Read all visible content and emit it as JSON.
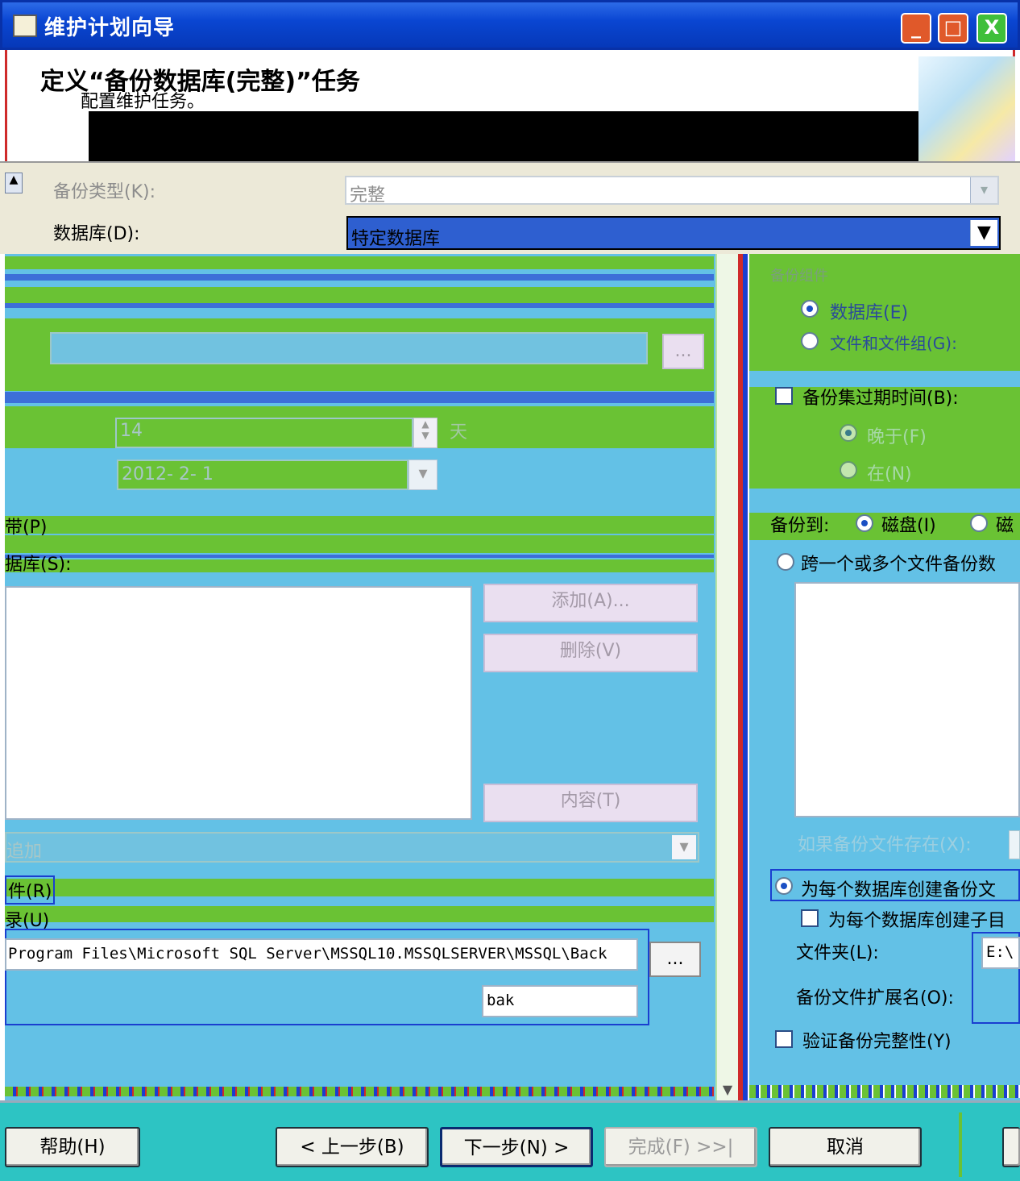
{
  "window": {
    "title": "维护计划向导",
    "minimize": "_",
    "maximize": "□",
    "close": "X"
  },
  "header": {
    "title": "定义“备份数据库(完整)”任务",
    "subtitle": "配置维护任务。"
  },
  "top": {
    "backup_type_label": "备份类型(K):",
    "backup_type_value": "完整",
    "database_label": "数据库(D):",
    "database_value": "特定数据库"
  },
  "left": {
    "browse": "...",
    "days_value": "14",
    "days_unit": "天",
    "date_value": "2012- 2- 1",
    "tape_label": "带(P)",
    "db_list_label": "据库(S):",
    "add_button": "添加(A)...",
    "remove_button": "删除(V)",
    "contents_button": "内容(T)",
    "append_value": "追加",
    "file_option": "件(R)",
    "dir_option": "录(U)",
    "folder_path": "Program Files\\Microsoft SQL Server\\MSSQL10.MSSQLSERVER\\MSSQL\\Back",
    "folder_browse": "...",
    "extension_value": "bak"
  },
  "right": {
    "group_title": "备份组件",
    "radio_database": "数据库(E)",
    "radio_files": "文件和文件组(G):",
    "expire_checkbox": "备份集过期时间(B):",
    "radio_after": "晚于(F)",
    "radio_on": "在(N)",
    "backup_to_label": "备份到:",
    "radio_disk": "磁盘(I)",
    "radio_tape": "磁",
    "span_files": "跨一个或多个文件备份数",
    "if_exists_label": "如果备份文件存在(X):",
    "create_per_db": "为每个数据库创建备份文",
    "create_subdir": "为每个数据库创建子目",
    "folder_label": "文件夹(L):",
    "folder_value": "E:\\",
    "ext_label": "备份文件扩展名(O):",
    "verify_checkbox": "验证备份完整性(Y)"
  },
  "footer": {
    "help": "帮助(H)",
    "back": "< 上一步(B)",
    "next": "下一步(N) >",
    "finish": "完成(F) >>|",
    "cancel": "取消"
  }
}
